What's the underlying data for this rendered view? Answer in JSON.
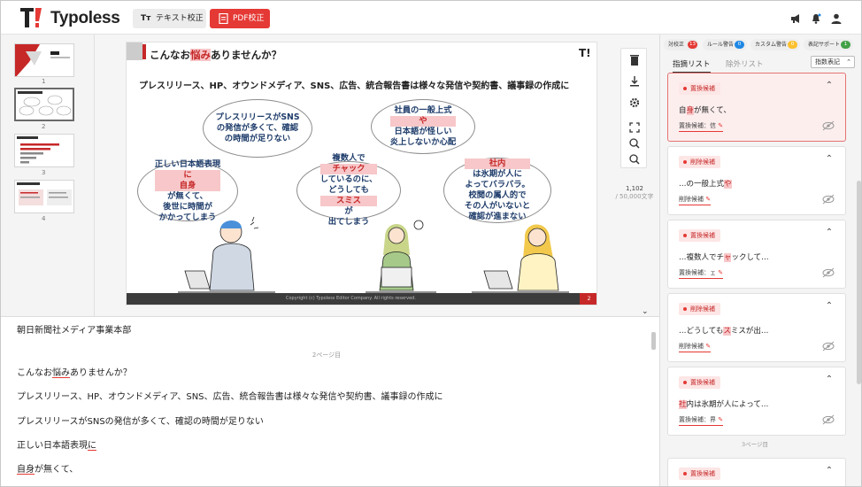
{
  "app": {
    "name": "Typoless",
    "logo_mark": "T!"
  },
  "header": {
    "text_button": {
      "icon": "Tт",
      "label": "テキスト校正"
    },
    "pdf_button": {
      "icon": "PDF",
      "label": "PDF校正"
    },
    "icons": [
      "megaphone-icon",
      "bell-icon",
      "user-icon"
    ]
  },
  "thumbnails": [
    {
      "page": "1"
    },
    {
      "page": "2",
      "selected": true
    },
    {
      "page": "3"
    },
    {
      "page": "4"
    }
  ],
  "slide": {
    "title_prefix": "こんなお",
    "title_hl": "悩み",
    "title_suffix": "ありませんか？",
    "logo": "T!",
    "subtitle": "プレスリリース、HP、オウンドメディア、SNS、広告、統合報告書は様々な発信や契約書、議事録の作成に",
    "bubbles": [
      {
        "lines": [
          "プレスリリースがSNS",
          "の発信が多くて、確認",
          "の時間が足りない"
        ]
      },
      {
        "lines": [
          "社員の一般上式",
          "日本語が怪しい",
          "炎上しないか心配"
        ],
        "hl": "や"
      },
      {
        "lines_before": "正しい日本語表現",
        "hl1": "に",
        "line2_hl": "自身",
        "line2_rest": "が無くて、",
        "lines_after": [
          "後世に時間が",
          "かかってしまう"
        ]
      },
      {
        "line1": "複数人で",
        "hl1": "チャック",
        "line2": "しているのに、",
        "line3a": "どうしても",
        "hl3": "スミス",
        "line3b": "が",
        "line4": "出てしまう"
      },
      {
        "hl1": "社内",
        "line1": "は氷期が人に",
        "line2": "よってバラバラ。",
        "line3": "校閲の属人的で",
        "line4": "その人がいないと",
        "line5": "確認が進まない"
      }
    ],
    "footer_text": "Copyright (c) Typoless Editor Company. All rights reserved.",
    "page_no": "2"
  },
  "viewer": {
    "page_count": "1,102",
    "page_total": "/ 50,000文字"
  },
  "text_panel": {
    "lines": [
      {
        "text": "朝日新聞社メディア事業本部"
      },
      {
        "pagemark": "2ページ目"
      },
      {
        "a": "こんなお",
        "u": "悩み",
        "b": "ありませんか？"
      },
      {
        "text": "プレスリリース、HP、オウンドメディア、SNS、広告、統合報告書は様々な発信や契約書、議事録の作成に"
      },
      {
        "text": "プレスリリースがSNSの発信が多くて、確認の時間が足りない"
      },
      {
        "a": "正しい日本語表現",
        "u": "に",
        "b": ""
      },
      {
        "a": "",
        "u": "自身",
        "b": "が無くて、"
      }
    ]
  },
  "right_panel": {
    "chips": [
      {
        "label": "対校正",
        "count": "13",
        "color": "#e53935"
      },
      {
        "label": "ルール警告",
        "count": "0",
        "color": "#1e88e5"
      },
      {
        "label": "カスタム警告",
        "count": "0",
        "color": "#fbc02d"
      },
      {
        "label": "表記サポート",
        "count": "1",
        "color": "#43a047"
      }
    ],
    "tabs": [
      "指摘リスト",
      "除外リスト"
    ],
    "sort_label": "指数表記",
    "cards": [
      {
        "badge": "置換候補",
        "text_a": "自",
        "text_u": "身",
        "text_b": "が無くて、",
        "cand": "置換候補：信",
        "active": true
      },
      {
        "badge": "削除候補",
        "text_a": "…の一般上式",
        "text_u": "や",
        "text_b": "",
        "cand": "削除候補"
      },
      {
        "badge": "置換候補",
        "text_a": "…複数人でチ",
        "text_u": "ャ",
        "text_b": "ックして…",
        "cand": "置換候補：ェ"
      },
      {
        "badge": "削除候補",
        "text_a": "…どうしても",
        "text_u": "ス",
        "text_b": "ミスが出…",
        "cand": "削除候補"
      },
      {
        "badge": "置換候補",
        "text_a": "",
        "text_u": "社",
        "text_b": "内は氷期が人によって…",
        "cand": "置換候補：界"
      },
      {
        "badge": "置換候補"
      }
    ],
    "pagemark": "3ページ目"
  }
}
